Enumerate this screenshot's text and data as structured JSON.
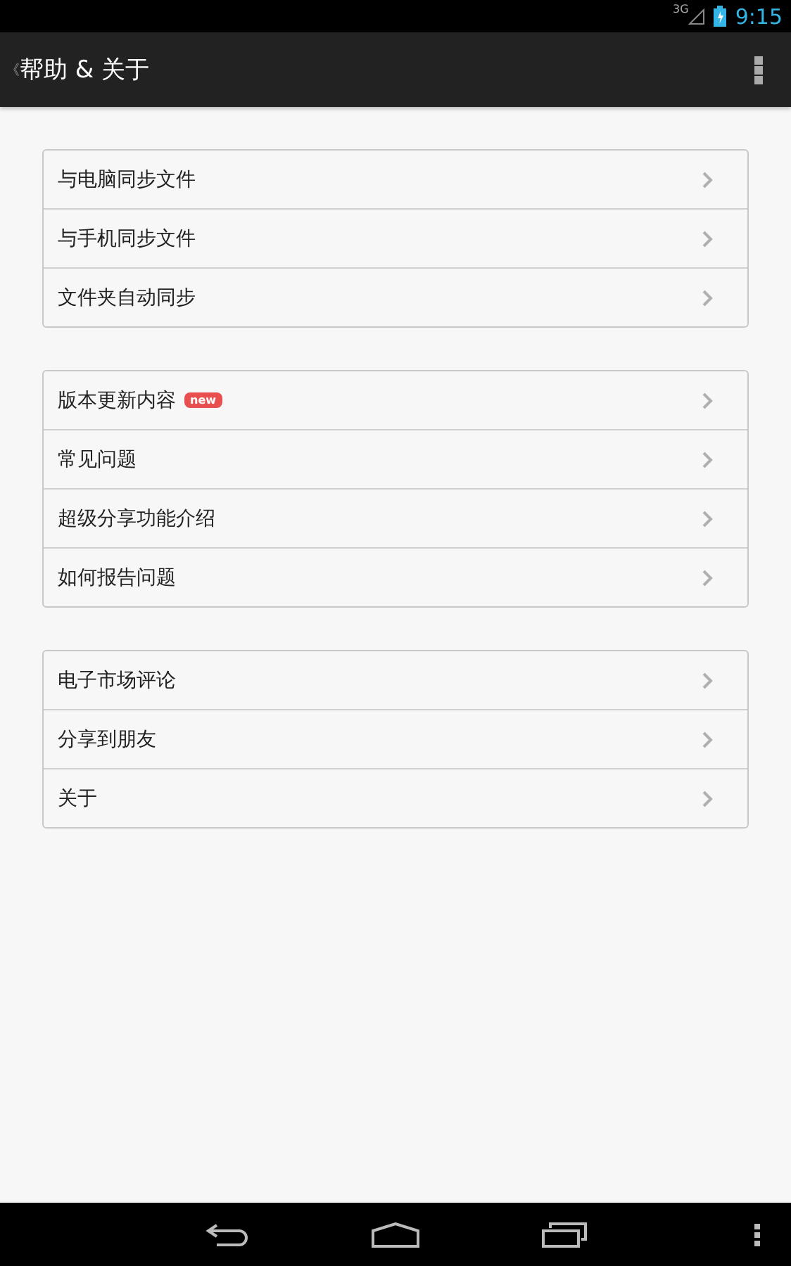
{
  "status_bar": {
    "network": "3G",
    "time": "9:15"
  },
  "action_bar": {
    "back": "《",
    "title": "帮助 & 关于"
  },
  "groups": [
    {
      "items": [
        {
          "label": "与电脑同步文件"
        },
        {
          "label": "与手机同步文件"
        },
        {
          "label": "文件夹自动同步"
        }
      ]
    },
    {
      "items": [
        {
          "label": "版本更新内容",
          "badge": "new"
        },
        {
          "label": "常见问题"
        },
        {
          "label": "超级分享功能介绍"
        },
        {
          "label": "如何报告问题"
        }
      ]
    },
    {
      "items": [
        {
          "label": "电子市场评论"
        },
        {
          "label": "分享到朋友"
        },
        {
          "label": "关于"
        }
      ]
    }
  ]
}
